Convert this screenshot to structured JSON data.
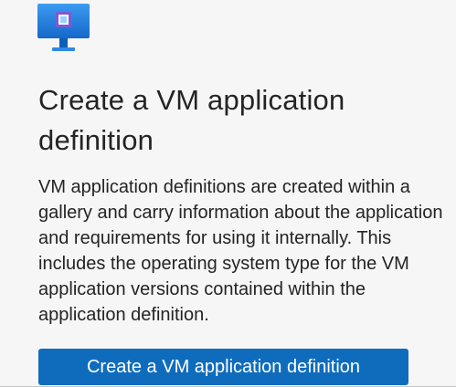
{
  "empty_state": {
    "icon": "vm-application-icon",
    "title": "Create a VM application definition",
    "description": "VM application definitions are created within a gallery and carry information about the application and requirements for using it internally. This includes the operating system type for the VM application versions contained within the application definition.",
    "button_label": "Create a VM application definition"
  },
  "colors": {
    "accent": "#0f6cbd",
    "icon_blue": "#1f83e0",
    "icon_purple": "#7b5bd6"
  }
}
